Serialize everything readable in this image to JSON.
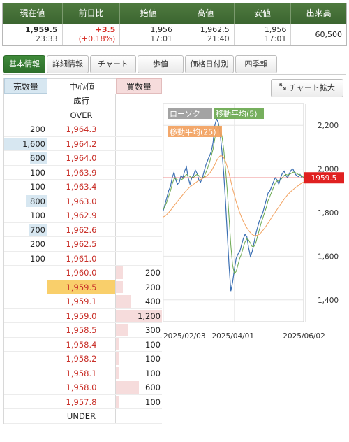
{
  "quote": {
    "headers": [
      "現在値",
      "前日比",
      "始値",
      "高値",
      "安値",
      "出来高"
    ],
    "current_price": "1,959.5",
    "current_time": "23:33",
    "change": "+3.5",
    "change_pct": "(+0.18%)",
    "open_price": "1,956",
    "open_time": "17:01",
    "high_price": "1,962.5",
    "high_time": "21:40",
    "low_price": "1,956",
    "low_time": "17:01",
    "volume": "60,500",
    "colors": {
      "header_bg": "#467137",
      "up": "#d6261e"
    }
  },
  "tabs": [
    {
      "label": "基本情報",
      "active": true
    },
    {
      "label": "詳細情報",
      "active": false
    },
    {
      "label": "チャート",
      "active": false
    },
    {
      "label": "歩値",
      "active": false
    },
    {
      "label": "価格日付別",
      "active": false
    },
    {
      "label": "四季報",
      "active": false
    }
  ],
  "chart_expand_label": "チャート拡大",
  "book": {
    "headers": {
      "sell": "売数量",
      "mid": "中心値",
      "buy": "買数量"
    },
    "rows": [
      {
        "sell": "",
        "price": "成行",
        "buy": "",
        "kind": "label",
        "sell_frac": 0,
        "buy_frac": 0
      },
      {
        "sell": "",
        "price": "OVER",
        "buy": "",
        "kind": "label",
        "sell_frac": 0,
        "buy_frac": 0
      },
      {
        "sell": "200",
        "price": "1,964.3",
        "buy": "",
        "kind": "price",
        "sell_frac": 0,
        "buy_frac": 0
      },
      {
        "sell": "1,600",
        "price": "1,964.2",
        "buy": "",
        "kind": "price",
        "sell_frac": 1.0,
        "buy_frac": 0
      },
      {
        "sell": "600",
        "price": "1,964.0",
        "buy": "",
        "kind": "price",
        "sell_frac": 0.4,
        "buy_frac": 0
      },
      {
        "sell": "100",
        "price": "1,963.9",
        "buy": "",
        "kind": "price",
        "sell_frac": 0,
        "buy_frac": 0
      },
      {
        "sell": "100",
        "price": "1,963.4",
        "buy": "",
        "kind": "price",
        "sell_frac": 0,
        "buy_frac": 0
      },
      {
        "sell": "800",
        "price": "1,963.0",
        "buy": "",
        "kind": "price",
        "sell_frac": 0.5,
        "buy_frac": 0
      },
      {
        "sell": "100",
        "price": "1,962.9",
        "buy": "",
        "kind": "price",
        "sell_frac": 0,
        "buy_frac": 0
      },
      {
        "sell": "700",
        "price": "1,962.6",
        "buy": "",
        "kind": "price",
        "sell_frac": 0.43,
        "buy_frac": 0
      },
      {
        "sell": "200",
        "price": "1,962.5",
        "buy": "",
        "kind": "price",
        "sell_frac": 0,
        "buy_frac": 0
      },
      {
        "sell": "100",
        "price": "1,961.0",
        "buy": "",
        "kind": "price",
        "sell_frac": 0,
        "buy_frac": 0
      },
      {
        "sell": "",
        "price": "1,960.0",
        "buy": "200",
        "kind": "price",
        "sell_frac": 0,
        "buy_frac": 0.15
      },
      {
        "sell": "",
        "price": "1,959.5",
        "buy": "200",
        "kind": "current",
        "sell_frac": 0,
        "buy_frac": 0.15
      },
      {
        "sell": "",
        "price": "1,959.1",
        "buy": "400",
        "kind": "price",
        "sell_frac": 0,
        "buy_frac": 0.33
      },
      {
        "sell": "",
        "price": "1,959.0",
        "buy": "1,200",
        "kind": "price",
        "sell_frac": 0,
        "buy_frac": 1.0
      },
      {
        "sell": "",
        "price": "1,958.5",
        "buy": "300",
        "kind": "price",
        "sell_frac": 0,
        "buy_frac": 0.25
      },
      {
        "sell": "",
        "price": "1,958.4",
        "buy": "100",
        "kind": "price",
        "sell_frac": 0,
        "buy_frac": 0.08
      },
      {
        "sell": "",
        "price": "1,958.2",
        "buy": "100",
        "kind": "price",
        "sell_frac": 0,
        "buy_frac": 0.08
      },
      {
        "sell": "",
        "price": "1,958.1",
        "buy": "100",
        "kind": "price",
        "sell_frac": 0,
        "buy_frac": 0.08
      },
      {
        "sell": "",
        "price": "1,958.0",
        "buy": "600",
        "kind": "price",
        "sell_frac": 0,
        "buy_frac": 0.5
      },
      {
        "sell": "",
        "price": "1,957.8",
        "buy": "100",
        "kind": "price",
        "sell_frac": 0,
        "buy_frac": 0.08
      },
      {
        "sell": "",
        "price": "UNDER",
        "buy": "",
        "kind": "label",
        "sell_frac": 0,
        "buy_frac": 0
      }
    ]
  },
  "chart_data": {
    "type": "line",
    "legend": [
      {
        "name": "ローソク",
        "color": "#9b9b9b"
      },
      {
        "name": "移動平均(5)",
        "color": "#6aa84f"
      },
      {
        "name": "移動平均(25)",
        "color": "#f2a15e"
      }
    ],
    "ylim": [
      1300,
      2300
    ],
    "y_ticks": [
      "2,200",
      "2,000",
      "1,800",
      "1,600",
      "1,400"
    ],
    "y_tick_values": [
      2200,
      2000,
      1800,
      1600,
      1400
    ],
    "x_ticks": [
      "2025/02/03",
      "2025/04/01",
      "2025/06/02"
    ],
    "x_tick_index": [
      0,
      40,
      80
    ],
    "current_value": 1959.5,
    "current_label": "1959.5",
    "current_color": "#e02020",
    "series": [
      {
        "name": "ローソク",
        "values": [
          1810,
          1840,
          1870,
          1900,
          1920,
          1960,
          1985,
          1950,
          1930,
          1940,
          1970,
          1960,
          1990,
          2010,
          1960,
          1930,
          1960,
          1970,
          1995,
          1980,
          1950,
          1940,
          1960,
          1990,
          2020,
          2040,
          2060,
          2080,
          2120,
          2200,
          2230,
          2210,
          2160,
          2080,
          1980,
          1850,
          1700,
          1560,
          1440,
          1480,
          1540,
          1590,
          1610,
          1620,
          1650,
          1680,
          1700,
          1690,
          1640,
          1600,
          1620,
          1660,
          1700,
          1730,
          1760,
          1780,
          1800,
          1830,
          1860,
          1890,
          1900,
          1920,
          1940,
          1960,
          1950,
          1930,
          1960,
          1980,
          1990,
          1970,
          1960,
          1980,
          1995,
          2000,
          1980,
          1970,
          1965,
          1975,
          1960,
          1959
        ]
      },
      {
        "name": "移動平均(5)",
        "values": [
          1815,
          1830,
          1850,
          1875,
          1900,
          1930,
          1955,
          1955,
          1950,
          1948,
          1950,
          1955,
          1965,
          1975,
          1970,
          1965,
          1960,
          1962,
          1970,
          1975,
          1970,
          1960,
          1958,
          1965,
          1985,
          2005,
          2030,
          2060,
          2090,
          2140,
          2180,
          2200,
          2190,
          2150,
          2090,
          2000,
          1900,
          1780,
          1650,
          1560,
          1520,
          1530,
          1560,
          1590,
          1610,
          1640,
          1665,
          1680,
          1675,
          1660,
          1645,
          1645,
          1660,
          1690,
          1720,
          1750,
          1775,
          1800,
          1825,
          1855,
          1875,
          1895,
          1915,
          1935,
          1945,
          1945,
          1950,
          1960,
          1970,
          1975,
          1972,
          1975,
          1980,
          1985,
          1985,
          1980,
          1975,
          1972,
          1968,
          1962
        ]
      },
      {
        "name": "移動平均(25)",
        "values": [
          1780,
          1785,
          1792,
          1800,
          1810,
          1820,
          1832,
          1842,
          1852,
          1862,
          1872,
          1882,
          1892,
          1902,
          1910,
          1918,
          1924,
          1930,
          1936,
          1942,
          1948,
          1952,
          1956,
          1960,
          1966,
          1972,
          1980,
          1990,
          2005,
          2020,
          2038,
          2052,
          2060,
          2060,
          2052,
          2035,
          2010,
          1980,
          1945,
          1910,
          1880,
          1850,
          1825,
          1800,
          1780,
          1760,
          1745,
          1730,
          1718,
          1708,
          1700,
          1695,
          1694,
          1696,
          1700,
          1708,
          1718,
          1728,
          1740,
          1752,
          1765,
          1778,
          1790,
          1802,
          1814,
          1826,
          1838,
          1850,
          1862,
          1872,
          1882,
          1890,
          1898,
          1905,
          1912,
          1918,
          1924,
          1930,
          1936,
          1940
        ]
      }
    ]
  }
}
